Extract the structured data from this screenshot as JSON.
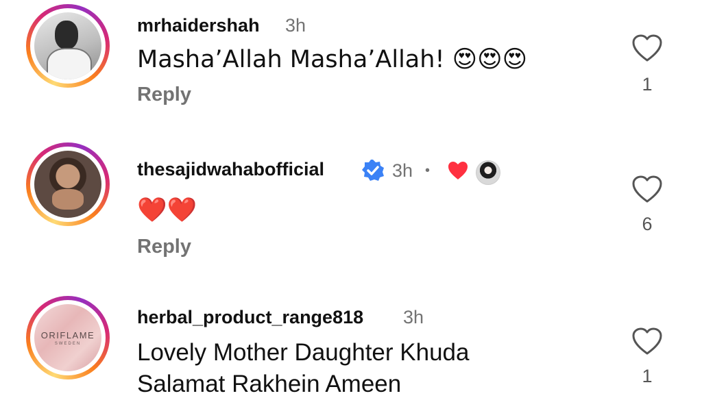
{
  "comments": [
    {
      "username": "mrhaidershah",
      "time": "3h",
      "text": "Masha’Allah Masha’Allah! 😍😍😍",
      "reply_label": "Reply",
      "likes": "1",
      "verified": false
    },
    {
      "username": "thesajidwahabofficial",
      "time": "3h",
      "separator": "•",
      "text": "❤️❤️",
      "reply_label": "Reply",
      "likes": "6",
      "verified": true,
      "liked_by_creator": true
    },
    {
      "username": "herbal_product_range818",
      "time": "3h",
      "text_line1": "Lovely Mother Daughter Khuda",
      "text_line2": "Salamat Rakhein Ameen",
      "likes": "1",
      "verified": false,
      "avatar_brand": "ORIFLAME",
      "avatar_sub": "SWEDEN"
    }
  ],
  "colors": {
    "text": "#111111",
    "muted": "#737373",
    "heart_red": "#ff3040",
    "verified_blue": "#3b82f6",
    "story_ring": [
      "#feda75",
      "#fa7e1e",
      "#d62976",
      "#962fbf"
    ]
  },
  "icons": [
    "heart-outline-icon",
    "verified-badge-icon",
    "creator-heart-icon"
  ]
}
